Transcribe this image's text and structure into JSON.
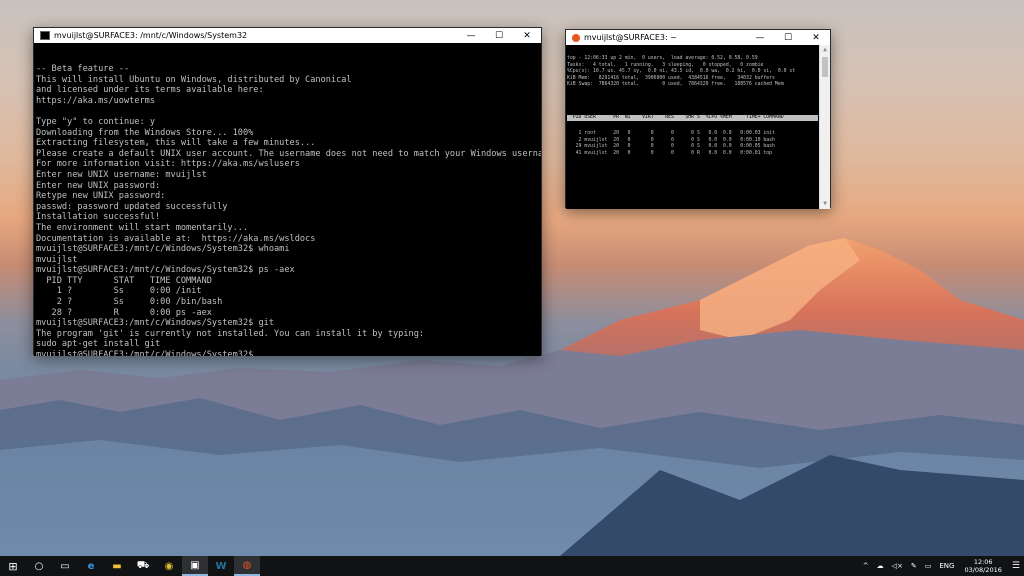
{
  "console": {
    "title": "mvuijlst@SURFACE3: /mnt/c/Windows/System32",
    "lines": [
      "-- Beta feature --",
      "This will install Ubuntu on Windows, distributed by Canonical",
      "and licensed under its terms available here:",
      "https://aka.ms/uowterms",
      "",
      "Type \"y\" to continue: y",
      "Downloading from the Windows Store... 100%",
      "Extracting filesystem, this will take a few minutes...",
      "Please create a default UNIX user account. The username does not need to match your Windows username.",
      "For more information visit: https://aka.ms/wslusers",
      "Enter new UNIX username: mvuijlst",
      "Enter new UNIX password:",
      "Retype new UNIX password:",
      "passwd: password updated successfully",
      "Installation successful!",
      "The environment will start momentarily...",
      "Documentation is available at:  https://aka.ms/wsldocs",
      "mvuijlst@SURFACE3:/mnt/c/Windows/System32$ whoami",
      "mvuijlst",
      "mvuijlst@SURFACE3:/mnt/c/Windows/System32$ ps -aex",
      "  PID TTY      STAT   TIME COMMAND",
      "    1 ?        Ss     0:00 /init",
      "    2 ?        Ss     0:00 /bin/bash",
      "   28 ?        R      0:00 ps -aex",
      "mvuijlst@SURFACE3:/mnt/c/Windows/System32$ git",
      "The program 'git' is currently not installed. You can install it by typing:",
      "sudo apt-get install git",
      "mvuijlst@SURFACE3:/mnt/c/Windows/System32$"
    ]
  },
  "top_window": {
    "title": "mvuijlst@SURFACE3: ~",
    "summary": [
      "top - 12:06:33 up 2 min,  0 users,  load average: 0.52, 0.58, 0.59",
      "Tasks:   4 total,   1 running,   3 sleeping,   0 stopped,   0 zombie",
      "%Cpu(s): 10.7 us, 45.7 sy,  0.0 ni, 43.5 id,  0.0 wa,  0.2 hi,  0.0 si,  0.0 st",
      "KiB Mem:   8291416 total,  3906900 used,  4384516 free,    34032 buffers",
      "KiB Swap:  7864320 total,        0 used,  7864320 free.   188576 cached Mem"
    ],
    "header": "  PID USER      PR  NI    VIRT    RES    SHR S  %CPU %MEM     TIME+ COMMAND",
    "rows": [
      "    1 root      20   0       0      0      0 S   0.0  0.0   0:00.03 init",
      "    2 mvuijlst  20   0       0      0      0 S   0.0  0.0   0:00.10 bash",
      "   29 mvuijlst  20   0       0      0      0 S   0.0  0.0   0:00.05 bash",
      "   41 mvuijlst  20   0       0      0      0 R   0.0  0.0   0:00.01 top"
    ]
  },
  "window_controls": {
    "minimize": "—",
    "maximize": "☐",
    "close": "✕"
  },
  "taskbar": {
    "start": "⊞",
    "search": "○",
    "taskview": "▭",
    "apps": [
      "e",
      "▬",
      "⛟",
      "◉",
      "▣",
      "W",
      "◍"
    ],
    "tray_icons": [
      "^",
      "☁",
      "◁×",
      "✎",
      "▭"
    ],
    "language": "ENG",
    "time": "12:06",
    "date": "03/08/2016",
    "notifications": "☰"
  },
  "colors": {
    "accent": "#0078d7",
    "ubuntu_orange": "#e95420",
    "taskbar": "#101214"
  }
}
